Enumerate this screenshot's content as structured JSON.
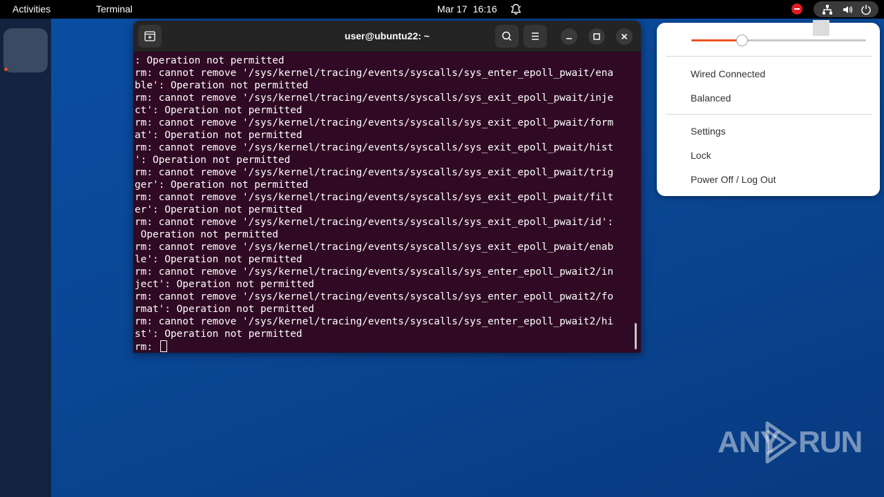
{
  "topbar": {
    "activities": "Activities",
    "app_name": "Terminal",
    "date": "Mar 17",
    "time": "16:16",
    "icons": [
      "notification-bell-icon",
      "do-not-disturb-icon",
      "network-wired-icon",
      "volume-icon",
      "power-icon"
    ]
  },
  "dock": {
    "apps": [
      "terminal-app"
    ]
  },
  "terminal": {
    "title": "user@ubuntu22: ~",
    "header_icons": [
      "new-tab-icon",
      "search-icon",
      "hamburger-menu-icon",
      "minimize-icon",
      "maximize-icon",
      "close-icon"
    ],
    "lines": [
      ": Operation not permitted",
      "rm: cannot remove '/sys/kernel/tracing/events/syscalls/sys_enter_epoll_pwait/ena",
      "ble': Operation not permitted",
      "rm: cannot remove '/sys/kernel/tracing/events/syscalls/sys_exit_epoll_pwait/inje",
      "ct': Operation not permitted",
      "rm: cannot remove '/sys/kernel/tracing/events/syscalls/sys_exit_epoll_pwait/form",
      "at': Operation not permitted",
      "rm: cannot remove '/sys/kernel/tracing/events/syscalls/sys_exit_epoll_pwait/hist",
      "': Operation not permitted",
      "rm: cannot remove '/sys/kernel/tracing/events/syscalls/sys_exit_epoll_pwait/trig",
      "ger': Operation not permitted",
      "rm: cannot remove '/sys/kernel/tracing/events/syscalls/sys_exit_epoll_pwait/filt",
      "er': Operation not permitted",
      "rm: cannot remove '/sys/kernel/tracing/events/syscalls/sys_exit_epoll_pwait/id':",
      " Operation not permitted",
      "rm: cannot remove '/sys/kernel/tracing/events/syscalls/sys_exit_epoll_pwait/enab",
      "le': Operation not permitted",
      "rm: cannot remove '/sys/kernel/tracing/events/syscalls/sys_enter_epoll_pwait2/in",
      "ject': Operation not permitted",
      "rm: cannot remove '/sys/kernel/tracing/events/syscalls/sys_enter_epoll_pwait2/fo",
      "rmat': Operation not permitted",
      "rm: cannot remove '/sys/kernel/tracing/events/syscalls/sys_enter_epoll_pwait2/hi",
      "st': Operation not permitted"
    ],
    "prompt": "rm: "
  },
  "quick_settings": {
    "volume_level": 0.29,
    "items": [
      {
        "label": "Wired Connected",
        "icon": "network-wired-icon"
      },
      {
        "label": "Balanced",
        "icon": "power-profile-icon"
      },
      {
        "label": "Settings",
        "icon": "gear-icon"
      },
      {
        "label": "Lock",
        "icon": "lock-icon"
      },
      {
        "label": "Power Off / Log Out",
        "icon": "power-icon"
      }
    ]
  },
  "watermark": {
    "left": "ANY",
    "right": "RUN"
  },
  "colors": {
    "terminal_bg": "#300a24",
    "accent": "#e95420",
    "desktop_bg": "#0a4592"
  }
}
